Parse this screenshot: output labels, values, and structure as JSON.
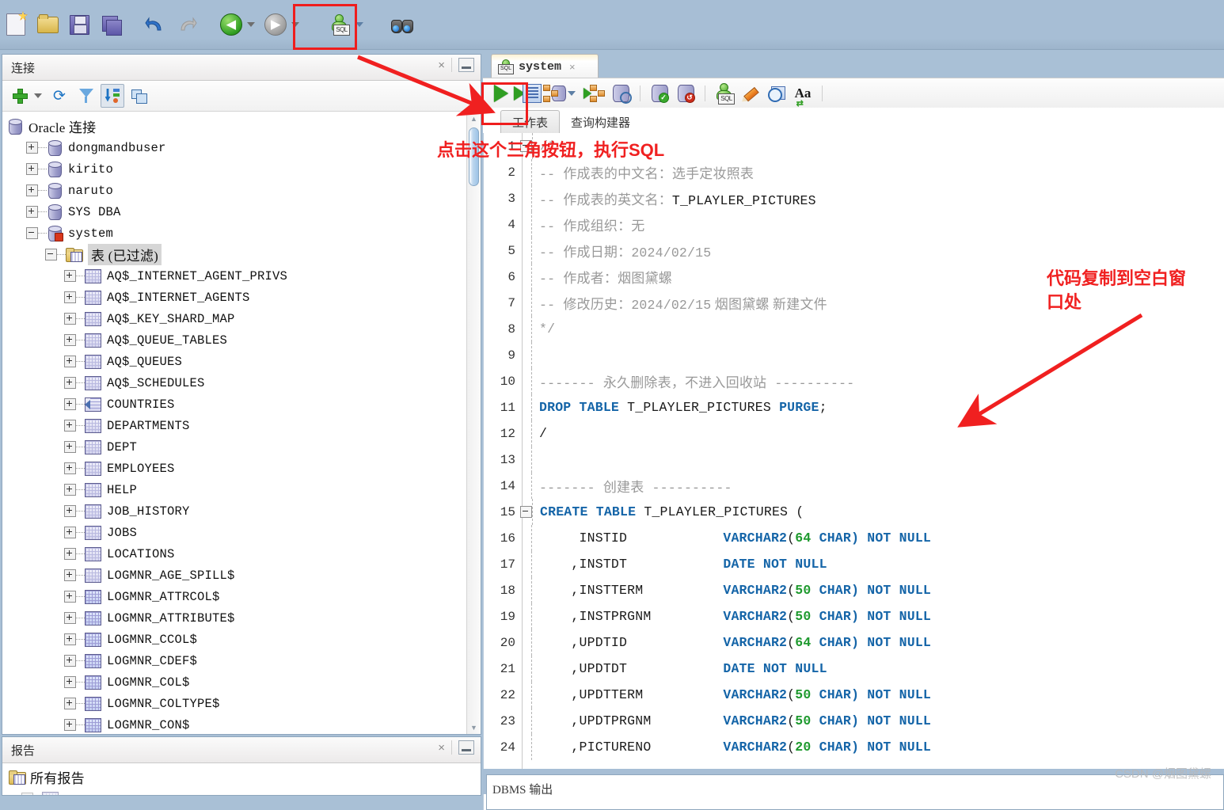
{
  "main_toolbar": {
    "items": [
      {
        "name": "new-file-button",
        "icon": "new-file-icon",
        "label": "新建"
      },
      {
        "name": "open-file-button",
        "icon": "open-folder-icon",
        "label": "打开"
      },
      {
        "name": "save-button",
        "icon": "save-icon",
        "label": "保存"
      },
      {
        "name": "save-all-button",
        "icon": "save-all-icon",
        "label": "全部保存"
      },
      {
        "name": "undo-button",
        "icon": "undo-icon",
        "label": "撤消"
      },
      {
        "name": "redo-button",
        "icon": "redo-icon",
        "label": "重做"
      },
      {
        "name": "back-button",
        "icon": "back-arrow-icon",
        "label": "后退"
      },
      {
        "name": "forward-button",
        "icon": "forward-arrow-icon",
        "label": "前进"
      },
      {
        "name": "new-sql-worksheet-button",
        "icon": "sql-worksheet-icon",
        "label": "SQL 工作表"
      },
      {
        "name": "find-button",
        "icon": "binoculars-icon",
        "label": "查找"
      }
    ]
  },
  "connections_panel": {
    "title": "连接",
    "close_label": "×",
    "toolbar": [
      {
        "name": "new-connection-button",
        "icon": "plus-icon",
        "label": "新建连接"
      },
      {
        "name": "new-connection-dropdown",
        "icon": "chevron-down-icon",
        "label": "更多"
      },
      {
        "name": "refresh-button",
        "icon": "refresh-icon",
        "label": "刷新"
      },
      {
        "name": "filter-button",
        "icon": "filter-icon",
        "label": "过滤"
      },
      {
        "name": "sort-button",
        "icon": "sort-list-icon",
        "label": "排序"
      },
      {
        "name": "freeze-pane-button",
        "icon": "panes-icon",
        "label": "冻结窗格"
      }
    ],
    "tree": [
      {
        "label": "Oracle 连接",
        "depth": 0,
        "icon": "db-icon",
        "expander": "none",
        "cjk": true
      },
      {
        "label": "dongmandbuser",
        "depth": 1,
        "icon": "db-icon",
        "expander": "plus"
      },
      {
        "label": "kirito",
        "depth": 1,
        "icon": "db-icon",
        "expander": "plus"
      },
      {
        "label": "naruto",
        "depth": 1,
        "icon": "db-icon",
        "expander": "plus"
      },
      {
        "label": "SYS DBA",
        "depth": 1,
        "icon": "db-icon",
        "expander": "plus"
      },
      {
        "label": "system",
        "depth": 1,
        "icon": "db-connected-icon",
        "expander": "minus"
      },
      {
        "label": "表 (已过滤)",
        "depth": 2,
        "icon": "table-folder-icon",
        "expander": "minus",
        "cjk": true,
        "selected": true
      },
      {
        "label": "AQ$_INTERNET_AGENT_PRIVS",
        "depth": 3,
        "icon": "grid-icon",
        "expander": "plus"
      },
      {
        "label": "AQ$_INTERNET_AGENTS",
        "depth": 3,
        "icon": "grid-icon",
        "expander": "plus"
      },
      {
        "label": "AQ$_KEY_SHARD_MAP",
        "depth": 3,
        "icon": "grid-icon",
        "expander": "plus"
      },
      {
        "label": "AQ$_QUEUE_TABLES",
        "depth": 3,
        "icon": "grid-icon",
        "expander": "plus"
      },
      {
        "label": "AQ$_QUEUES",
        "depth": 3,
        "icon": "grid-icon",
        "expander": "plus"
      },
      {
        "label": "AQ$_SCHEDULES",
        "depth": 3,
        "icon": "grid-icon",
        "expander": "plus"
      },
      {
        "label": "COUNTRIES",
        "depth": 3,
        "icon": "view-icon",
        "expander": "plus"
      },
      {
        "label": "DEPARTMENTS",
        "depth": 3,
        "icon": "grid-icon",
        "expander": "plus"
      },
      {
        "label": "DEPT",
        "depth": 3,
        "icon": "grid-icon",
        "expander": "plus"
      },
      {
        "label": "EMPLOYEES",
        "depth": 3,
        "icon": "grid-icon",
        "expander": "plus"
      },
      {
        "label": "HELP",
        "depth": 3,
        "icon": "grid-icon",
        "expander": "plus"
      },
      {
        "label": "JOB_HISTORY",
        "depth": 3,
        "icon": "grid-icon",
        "expander": "plus"
      },
      {
        "label": "JOBS",
        "depth": 3,
        "icon": "grid-icon",
        "expander": "plus"
      },
      {
        "label": "LOCATIONS",
        "depth": 3,
        "icon": "grid-icon",
        "expander": "plus"
      },
      {
        "label": "LOGMNR_AGE_SPILL$",
        "depth": 3,
        "icon": "grid-icon",
        "expander": "plus"
      },
      {
        "label": "LOGMNR_ATTRCOL$",
        "depth": 3,
        "icon": "grid-blue-icon",
        "expander": "plus"
      },
      {
        "label": "LOGMNR_ATTRIBUTE$",
        "depth": 3,
        "icon": "grid-blue-icon",
        "expander": "plus"
      },
      {
        "label": "LOGMNR_CCOL$",
        "depth": 3,
        "icon": "grid-blue-icon",
        "expander": "plus"
      },
      {
        "label": "LOGMNR_CDEF$",
        "depth": 3,
        "icon": "grid-blue-icon",
        "expander": "plus"
      },
      {
        "label": "LOGMNR_COL$",
        "depth": 3,
        "icon": "grid-blue-icon",
        "expander": "plus"
      },
      {
        "label": "LOGMNR_COLTYPE$",
        "depth": 3,
        "icon": "grid-blue-icon",
        "expander": "plus"
      },
      {
        "label": "LOGMNR_CON$",
        "depth": 3,
        "icon": "grid-blue-icon",
        "expander": "plus"
      }
    ]
  },
  "reports_panel": {
    "title": "报告",
    "close_label": "×",
    "items": [
      {
        "label": "所有报告",
        "icon": "reports-icon"
      }
    ]
  },
  "editor": {
    "tab": {
      "label": "system",
      "icon": "sql-connection-icon",
      "close_label": "×"
    },
    "toolbar": [
      {
        "name": "run-statement-button",
        "icon": "run-triangle-icon",
        "label": "执行语句"
      },
      {
        "name": "run-script-button",
        "icon": "run-script-icon",
        "label": "运行脚本"
      },
      {
        "name": "autotrace-button",
        "icon": "autotrace-icon",
        "label": "自动跟踪"
      },
      {
        "name": "autotrace-dropdown",
        "icon": "chevron-down-icon",
        "label": "更多"
      },
      {
        "name": "explain-plan-button",
        "icon": "explain-plan-icon",
        "label": "解释计划"
      },
      {
        "name": "sql-history-button",
        "icon": "sql-history-icon",
        "label": "SQL 历史记录"
      },
      {
        "name": "commit-button",
        "icon": "commit-icon",
        "label": "提交"
      },
      {
        "name": "rollback-button",
        "icon": "rollback-icon",
        "label": "回退"
      },
      {
        "name": "unshared-worksheet-button",
        "icon": "sql-new-icon",
        "label": "取消共享 SQL 工作表"
      },
      {
        "name": "clear-button",
        "icon": "eraser-icon",
        "label": "清除"
      },
      {
        "name": "timing-button",
        "icon": "timing-icon",
        "label": "计时"
      },
      {
        "name": "format-button",
        "icon": "format-aa-icon",
        "label": "格式化"
      }
    ],
    "subtabs": [
      {
        "label": "工作表",
        "active": true
      },
      {
        "label": "查询构建器",
        "active": false
      }
    ],
    "code_lines": [
      {
        "n": 1,
        "fold": "minus",
        "segments": [
          {
            "t": "/*",
            "c": "cmm"
          }
        ]
      },
      {
        "n": 2,
        "segments": [
          {
            "t": "-- ",
            "c": "cmm"
          },
          {
            "t": "作成表的中文名：选手定妆照表",
            "c": "cm"
          }
        ]
      },
      {
        "n": 3,
        "segments": [
          {
            "t": "-- ",
            "c": "cmm"
          },
          {
            "t": "作成表的英文名：",
            "c": "cm"
          },
          {
            "t": "T_PLAYLER_PICTURES",
            "c": "pl"
          }
        ]
      },
      {
        "n": 4,
        "segments": [
          {
            "t": "-- ",
            "c": "cmm"
          },
          {
            "t": "作成组织：无",
            "c": "cm"
          }
        ]
      },
      {
        "n": 5,
        "segments": [
          {
            "t": "-- ",
            "c": "cmm"
          },
          {
            "t": "作成日期：",
            "c": "cm"
          },
          {
            "t": "2024/02/15",
            "c": "cmm"
          }
        ]
      },
      {
        "n": 6,
        "segments": [
          {
            "t": "-- ",
            "c": "cmm"
          },
          {
            "t": "作成者：烟图黛螺",
            "c": "cm"
          }
        ]
      },
      {
        "n": 7,
        "segments": [
          {
            "t": "-- ",
            "c": "cmm"
          },
          {
            "t": "修改历史：",
            "c": "cm"
          },
          {
            "t": "2024/02/15",
            "c": "cmm"
          },
          {
            "t": " 烟图黛螺 新建文件",
            "c": "cm"
          }
        ]
      },
      {
        "n": 8,
        "segments": [
          {
            "t": "*/",
            "c": "cmm"
          }
        ]
      },
      {
        "n": 9,
        "segments": []
      },
      {
        "n": 10,
        "segments": [
          {
            "t": "------- ",
            "c": "cmm"
          },
          {
            "t": "永久删除表，不进入回收站",
            "c": "cm"
          },
          {
            "t": " ----------",
            "c": "cmm"
          }
        ]
      },
      {
        "n": 11,
        "segments": [
          {
            "t": "DROP TABLE ",
            "c": "kw"
          },
          {
            "t": "T_PLAYLER_PICTURES ",
            "c": "pl"
          },
          {
            "t": "PURGE",
            "c": "kw"
          },
          {
            "t": ";",
            "c": "pl"
          }
        ]
      },
      {
        "n": 12,
        "segments": [
          {
            "t": "/",
            "c": "pl"
          }
        ]
      },
      {
        "n": 13,
        "segments": []
      },
      {
        "n": 14,
        "segments": [
          {
            "t": "------- ",
            "c": "cmm"
          },
          {
            "t": "创建表",
            "c": "cm"
          },
          {
            "t": " ----------",
            "c": "cmm"
          }
        ]
      },
      {
        "n": 15,
        "fold": "minus",
        "segments": [
          {
            "t": "CREATE TABLE ",
            "c": "kw"
          },
          {
            "t": "T_PLAYLER_PICTURES (",
            "c": "pl"
          }
        ]
      },
      {
        "n": 16,
        "segments": [
          {
            "t": "     INSTID            ",
            "c": "pl"
          },
          {
            "t": "VARCHAR2",
            "c": "kw"
          },
          {
            "t": "(",
            "c": "pl"
          },
          {
            "t": "64",
            "c": "num"
          },
          {
            "t": " CHAR) NOT NULL",
            "c": "kw"
          }
        ]
      },
      {
        "n": 17,
        "segments": [
          {
            "t": "    ,INSTDT            ",
            "c": "pl"
          },
          {
            "t": "DATE NOT NULL",
            "c": "kw"
          }
        ]
      },
      {
        "n": 18,
        "segments": [
          {
            "t": "    ,INSTTERM          ",
            "c": "pl"
          },
          {
            "t": "VARCHAR2",
            "c": "kw"
          },
          {
            "t": "(",
            "c": "pl"
          },
          {
            "t": "50",
            "c": "num"
          },
          {
            "t": " CHAR) NOT NULL",
            "c": "kw"
          }
        ]
      },
      {
        "n": 19,
        "segments": [
          {
            "t": "    ,INSTPRGNM         ",
            "c": "pl"
          },
          {
            "t": "VARCHAR2",
            "c": "kw"
          },
          {
            "t": "(",
            "c": "pl"
          },
          {
            "t": "50",
            "c": "num"
          },
          {
            "t": " CHAR) NOT NULL",
            "c": "kw"
          }
        ]
      },
      {
        "n": 20,
        "segments": [
          {
            "t": "    ,UPDTID            ",
            "c": "pl"
          },
          {
            "t": "VARCHAR2",
            "c": "kw"
          },
          {
            "t": "(",
            "c": "pl"
          },
          {
            "t": "64",
            "c": "num"
          },
          {
            "t": " CHAR) NOT NULL",
            "c": "kw"
          }
        ]
      },
      {
        "n": 21,
        "segments": [
          {
            "t": "    ,UPDTDT            ",
            "c": "pl"
          },
          {
            "t": "DATE NOT NULL",
            "c": "kw"
          }
        ]
      },
      {
        "n": 22,
        "segments": [
          {
            "t": "    ,UPDTTERM          ",
            "c": "pl"
          },
          {
            "t": "VARCHAR2",
            "c": "kw"
          },
          {
            "t": "(",
            "c": "pl"
          },
          {
            "t": "50",
            "c": "num"
          },
          {
            "t": " CHAR) NOT NULL",
            "c": "kw"
          }
        ]
      },
      {
        "n": 23,
        "segments": [
          {
            "t": "    ,UPDTPRGNM         ",
            "c": "pl"
          },
          {
            "t": "VARCHAR2",
            "c": "kw"
          },
          {
            "t": "(",
            "c": "pl"
          },
          {
            "t": "50",
            "c": "num"
          },
          {
            "t": " CHAR) NOT NULL",
            "c": "kw"
          }
        ]
      },
      {
        "n": 24,
        "segments": [
          {
            "t": "    ,PICTURENO         ",
            "c": "pl"
          },
          {
            "t": "VARCHAR2",
            "c": "kw"
          },
          {
            "t": "(",
            "c": "pl"
          },
          {
            "t": "20",
            "c": "num"
          },
          {
            "t": " CHAR) NOT NULL",
            "c": "kw"
          }
        ]
      }
    ]
  },
  "dbms_output": {
    "label": "DBMS 输出"
  },
  "annotations": {
    "run_sql": "点击这个三角按钮，执行SQL",
    "paste_code": "代码复制到空白窗\n口处",
    "color": "#f02020"
  },
  "watermark": "CSDN @烟图黛螺"
}
